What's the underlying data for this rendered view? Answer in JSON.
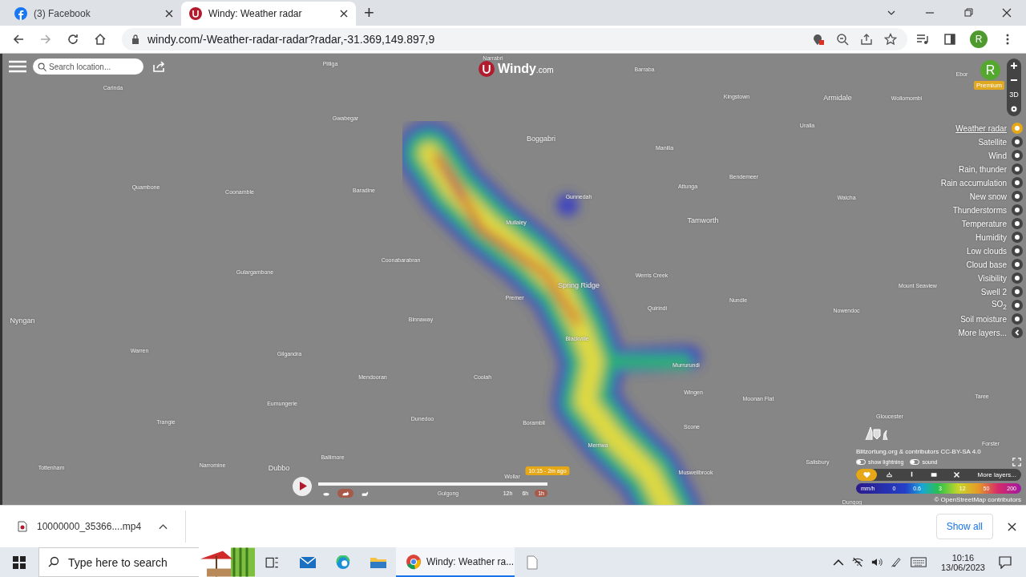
{
  "browser": {
    "tabs": [
      {
        "title": "(3) Facebook",
        "selected": false
      },
      {
        "title": "Windy: Weather radar",
        "selected": true
      }
    ],
    "new_tab": "+",
    "url": "windy.com/-Weather-radar-radar?radar,-31.369,149.897,9",
    "profile": "R"
  },
  "map": {
    "search": {
      "placeholder": "Search location..."
    },
    "logo": {
      "name": "Windy",
      "suffix": ".com"
    },
    "place_labels": [
      "Narrabri",
      "Pilliga",
      "Barraba",
      "Ebor",
      "Carinda",
      "Kingstown",
      "Armidale",
      "Wollomombi",
      "Gwabegar",
      "Uralla",
      "Boggabri",
      "Manilla",
      "Quambone",
      "Coonamble",
      "Baradine",
      "Attunga",
      "Bendemeer",
      "Walcha",
      "Gunnedah",
      "Mullaley",
      "Tamworth",
      "Gulargambone",
      "Coonabarabran",
      "Werris Creek",
      "Spring Ridge",
      "Mount Seaview",
      "Premer",
      "Nundle",
      "Quirindi",
      "Nowendoc",
      "Nyngan",
      "Binnaway",
      "Blackville",
      "Warren",
      "Gilgandra",
      "Murrurundi",
      "Mendooran",
      "Coolah",
      "Wingen",
      "Moonan Flat",
      "Eumungerie",
      "Dunedoo",
      "Taree",
      "Gloucester",
      "Trangie",
      "Borambil",
      "Scone",
      "Merriwa",
      "Forster",
      "Ballimore",
      "Salisbury",
      "Tottenham",
      "Narromine",
      "Dubbo",
      "Muswellbrook",
      "Gulgong",
      "Wollar",
      "Dungog"
    ],
    "controls": {
      "three_d": "3D",
      "avatar": "R",
      "badge": "Premium"
    },
    "layers": [
      {
        "label": "Weather radar",
        "selected": true
      },
      {
        "label": "Satellite",
        "selected": false
      },
      {
        "label": "Wind",
        "selected": false
      },
      {
        "label": "Rain, thunder",
        "selected": false
      },
      {
        "label": "Rain accumulation",
        "selected": false
      },
      {
        "label": "New snow",
        "selected": false
      },
      {
        "label": "Thunderstorms",
        "selected": false
      },
      {
        "label": "Temperature",
        "selected": false
      },
      {
        "label": "Humidity",
        "selected": false
      },
      {
        "label": "Low clouds",
        "selected": false
      },
      {
        "label": "Cloud base",
        "selected": false
      },
      {
        "label": "Visibility",
        "selected": false
      },
      {
        "label": "Swell 2",
        "selected": false
      },
      {
        "label": "SO$_{2}$",
        "selected": false
      },
      {
        "label": "Soil moisture",
        "selected": false
      },
      {
        "label": "More layers...",
        "selected": false
      }
    ],
    "attribution": "Blitzortung.org & contributors CC-BY-SA 4.0",
    "toggles": [
      {
        "label": "show lightning",
        "on": false
      },
      {
        "label": "sound",
        "on": false
      }
    ],
    "overlay_bar": {
      "items": [
        {
          "selected": true
        },
        {
          "selected": false
        },
        {
          "selected": false
        },
        {
          "selected": false
        },
        {
          "selected": false
        }
      ],
      "more": "More layers..."
    },
    "legend": {
      "unit": "mm/h",
      "values": [
        "0",
        "0.6",
        "3",
        "12",
        "50",
        "200"
      ]
    },
    "osm": "© OpenStreetMap contributors",
    "timeline": {
      "tooltip": "10:15 - 2m ago",
      "level": 1,
      "speeds": [
        {
          "selected": false
        },
        {
          "selected": true
        },
        {
          "selected": false
        }
      ],
      "ranges": [
        {
          "label": "12h",
          "selected": false
        },
        {
          "label": "6h",
          "selected": false
        },
        {
          "label": "1h",
          "selected": true
        }
      ]
    }
  },
  "download_bar": {
    "file": "10000000_35366....mp4",
    "show_all": "Show all"
  },
  "taskbar": {
    "search": {
      "placeholder": "Type here to search"
    },
    "app": "Windy: Weather ra...",
    "time": "10:16",
    "date": "13/06/2023"
  }
}
